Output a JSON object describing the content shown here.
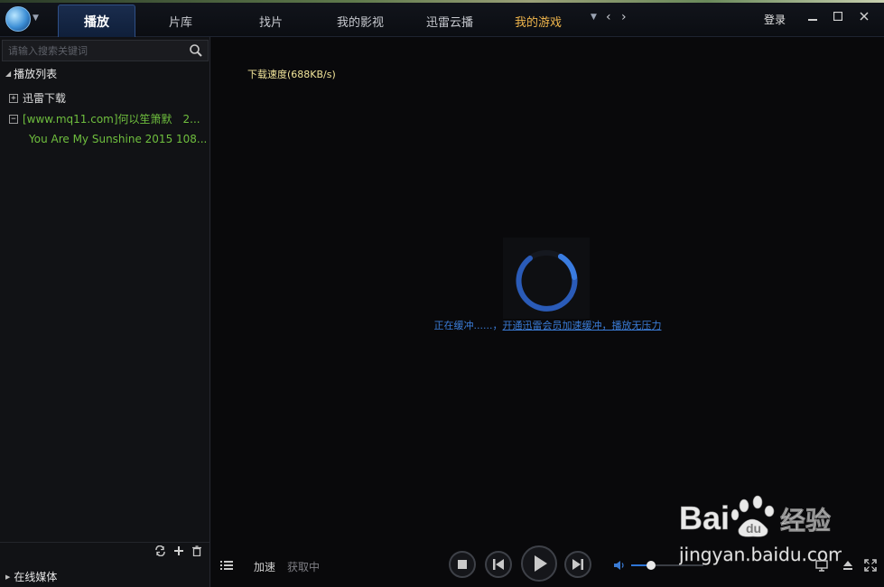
{
  "header": {
    "tabs": [
      {
        "label": "播放",
        "active": true
      },
      {
        "label": "片库"
      },
      {
        "label": "找片"
      },
      {
        "label": "我的影视"
      },
      {
        "label": "迅雷云播"
      },
      {
        "label": "我的游戏",
        "highlight": "#f0b64c"
      }
    ],
    "login_label": "登录"
  },
  "sidebar": {
    "search_placeholder": "请输入搜索关键词",
    "playlist_title": "播放列表",
    "items": [
      {
        "label": "迅雷下载",
        "expanded": false
      },
      {
        "label": "[www.mq11.com]何以笙箫默　2...",
        "expanded": true,
        "children": [
          "You Are My Sunshine 2015 108..."
        ]
      }
    ],
    "online_media": "在线媒体"
  },
  "main": {
    "download_speed": "下载速度(688KB/s)",
    "buffer_prefix": "正在缓冲......，",
    "buffer_link": "开通迅雷会员加速缓冲，播放无压力"
  },
  "controls": {
    "accelerate": "加速",
    "fetching": "获取中",
    "volume_level": 0.27
  },
  "watermark": {
    "brand": "Bai",
    "brand2": "du",
    "suffix": "经验",
    "url": "jingyan.baidu.com"
  },
  "colors": {
    "accent": "#2f75d6",
    "link": "#3a7bd5",
    "playlist_green": "#6fbf3e",
    "speed_yellow": "#f2e59a"
  }
}
